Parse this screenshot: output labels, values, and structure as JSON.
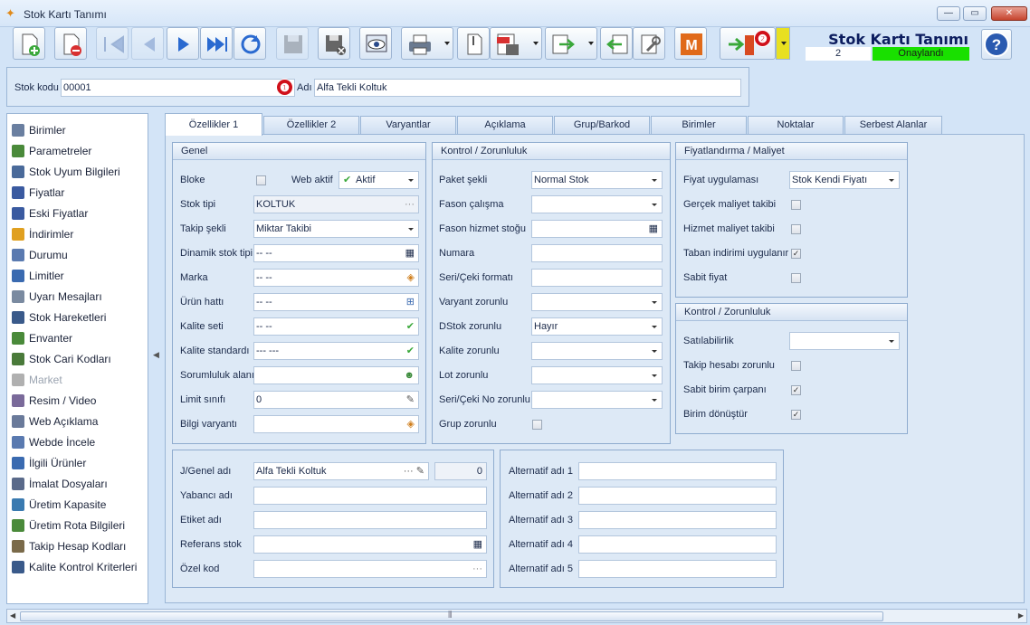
{
  "window": {
    "title": "Stok Kartı Tanımı",
    "controls": [
      "minimize",
      "maximize",
      "close"
    ]
  },
  "toolbar": {
    "buttons": [
      "new",
      "delete",
      "first",
      "previous",
      "next",
      "last",
      "refresh",
      "save",
      "cancel-save",
      "preview",
      "print",
      "attach",
      "pdf-save",
      "export",
      "import",
      "tools",
      "m-module",
      "exit"
    ],
    "badge1": "❶",
    "badge2": "❷"
  },
  "header": {
    "form_title": "Stok Kartı Tanımı",
    "status_number": "2",
    "status_text": "Onaylandı"
  },
  "code": {
    "label": "Stok kodu",
    "value": "00001",
    "name_label": "Adı",
    "name_value": "Alfa Tekli Koltuk"
  },
  "sidebar": {
    "items": [
      {
        "label": "Birimler",
        "color": "#6a7fa0"
      },
      {
        "label": "Parametreler",
        "color": "#4a8a3a"
      },
      {
        "label": "Stok Uyum Bilgileri",
        "color": "#4a6a9a"
      },
      {
        "label": "Fiyatlar",
        "color": "#3a5aa0"
      },
      {
        "label": "Eski Fiyatlar",
        "color": "#3a5aa0"
      },
      {
        "label": "İndirimler",
        "color": "#e0a020"
      },
      {
        "label": "Durumu",
        "color": "#5a7ab0"
      },
      {
        "label": "Limitler",
        "color": "#3a6ab0"
      },
      {
        "label": "Uyarı Mesajları",
        "color": "#7a8aa0"
      },
      {
        "label": "Stok Hareketleri",
        "color": "#3a5a8a"
      },
      {
        "label": "Envanter",
        "color": "#4a8a3a"
      },
      {
        "label": "Stok Cari Kodları",
        "color": "#4a7a3a"
      },
      {
        "label": "Market",
        "color": "#b0b0b0"
      },
      {
        "label": "Resim / Video",
        "color": "#7a6a9a"
      },
      {
        "label": "Web Açıklama",
        "color": "#6a7a9a"
      },
      {
        "label": "Webde İncele",
        "color": "#5a7ab0"
      },
      {
        "label": "İlgili Ürünler",
        "color": "#3a6ab0"
      },
      {
        "label": "İmalat Dosyaları",
        "color": "#5a6a8a"
      },
      {
        "label": "Üretim Kapasite",
        "color": "#3a7ab0"
      },
      {
        "label": "Üretim Rota Bilgileri",
        "color": "#4a8a3a"
      },
      {
        "label": "Takip Hesap Kodları",
        "color": "#7a6a4a"
      },
      {
        "label": "Kalite Kontrol Kriterleri",
        "color": "#3a5a8a"
      }
    ]
  },
  "tabs": [
    "Özellikler 1",
    "Özellikler 2",
    "Varyantlar",
    "Açıklama",
    "Grup/Barkod",
    "Birimler",
    "Noktalar",
    "Serbest Alanlar"
  ],
  "genel": {
    "title": "Genel",
    "bloke": "Bloke",
    "web_aktif": "Web aktif",
    "web_aktif_value": "Aktif",
    "stok_tipi": "Stok tipi",
    "stok_tipi_value": "KOLTUK",
    "takip_sekli": "Takip şekli",
    "takip_sekli_value": "Miktar Takibi",
    "dinamik": "Dinamik stok tipi",
    "dinamik_value": "-- --",
    "marka": "Marka",
    "marka_value": "-- --",
    "urun_hatti": "Ürün hattı",
    "urun_hatti_value": "-- --",
    "kalite_seti": "Kalite seti",
    "kalite_seti_value": "-- --",
    "kalite_std": "Kalite standardı",
    "kalite_std_value": "--- ---",
    "sorumluluk": "Sorumluluk alanı",
    "limit": "Limit sınıfı",
    "limit_value": "0",
    "bilgi": "Bilgi varyantı"
  },
  "kontrol": {
    "title": "Kontrol / Zorunluluk",
    "paket": "Paket şekli",
    "paket_value": "Normal Stok",
    "fason": "Fason çalışma",
    "fason_hizmet": "Fason hizmet stoğu",
    "numara": "Numara",
    "seri_format": "Seri/Çeki formatı",
    "varyant": "Varyant zorunlu",
    "dstok": "DStok zorunlu",
    "dstok_value": "Hayır",
    "kalite": "Kalite zorunlu",
    "lot": "Lot zorunlu",
    "seri_no": "Seri/Çeki No zorunlu",
    "grup": "Grup zorunlu"
  },
  "fiyat": {
    "title": "Fiyatlandırma / Maliyet",
    "uygulama": "Fiyat uygulaması",
    "uygulama_value": "Stok Kendi Fiyatı",
    "gercek": "Gerçek maliyet takibi",
    "hizmet": "Hizmet maliyet takibi",
    "taban": "Taban indirimi uygulanır",
    "sabit": "Sabit fiyat"
  },
  "kontrol2": {
    "title": "Kontrol / Zorunluluk",
    "satilabilirlik": "Satılabilirlik",
    "takip_hesabi": "Takip hesabı zorunlu",
    "sabit_birim": "Sabit birim çarpanı",
    "birim_donustur": "Birim dönüştür"
  },
  "names": {
    "genel_adi": "J/Genel adı",
    "genel_adi_value": "Alfa Tekli Koltuk",
    "genel_count": "0",
    "yabanci": "Yabancı adı",
    "etiket": "Etiket adı",
    "referans": "Referans stok",
    "ozel": "Özel kod",
    "alt1": "Alternatif adı 1",
    "alt2": "Alternatif adı 2",
    "alt3": "Alternatif adı 3",
    "alt4": "Alternatif adı 4",
    "alt5": "Alternatif adı 5"
  }
}
